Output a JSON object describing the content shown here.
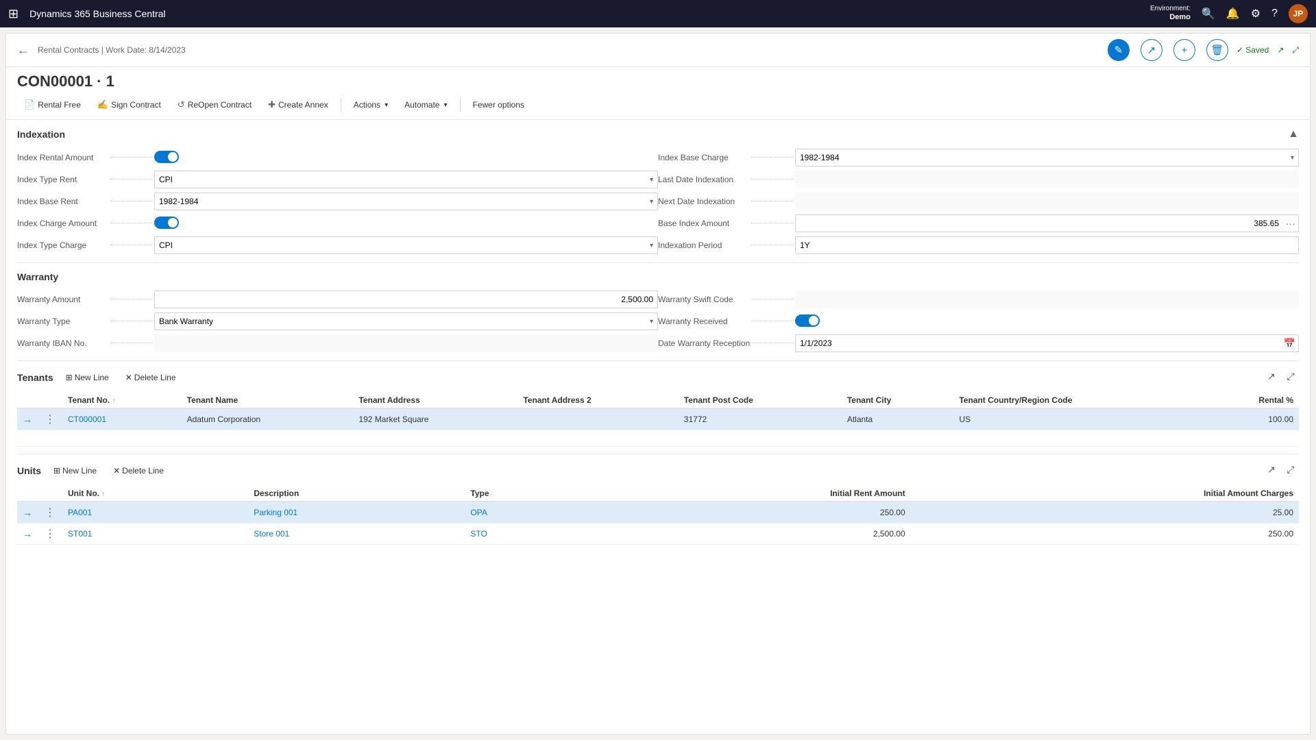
{
  "topNav": {
    "appGridIcon": "⊞",
    "appTitle": "Dynamics 365 Business Central",
    "envLabel": "Environment:",
    "envName": "Demo",
    "searchIcon": "🔍",
    "bellIcon": "🔔",
    "gearIcon": "⚙",
    "helpIcon": "?",
    "avatarInitial": "JP"
  },
  "pageHeader": {
    "backIcon": "←",
    "breadcrumb": "Rental Contracts | Work Date: 8/14/2023",
    "editIcon": "✎",
    "shareIcon": "↗",
    "addIcon": "+",
    "deleteIcon": "🗑",
    "savedLabel": "✓ Saved",
    "openNewIcon": "↗",
    "expandIcon": "⤢"
  },
  "recordTitle": "CON00001 · 1",
  "actionBar": {
    "rentalFreeLabel": "Rental Free",
    "rentalFreeIcon": "📄",
    "signContractLabel": "Sign Contract",
    "signContractIcon": "✍",
    "reopenContractLabel": "ReOpen Contract",
    "reopenContractIcon": "↺",
    "createAnnexLabel": "Create Annex",
    "createAnnexIcon": "✚",
    "actionsLabel": "Actions",
    "automateLabel": "Automate",
    "fewerOptionsLabel": "Fewer options"
  },
  "indexation": {
    "sectionTitle": "Indexation",
    "indexRentalAmountLabel": "Index Rental Amount",
    "indexRentalAmountValue": "on",
    "indexTypeRentLabel": "Index Type Rent",
    "indexTypeRentValue": "CPI",
    "indexBaseRentLabel": "Index Base Rent",
    "indexBaseRentValue": "1982-1984",
    "indexChargeAmountLabel": "Index Charge Amount",
    "indexChargeAmountValue": "on",
    "indexTypeChargeLabel": "Index Type Charge",
    "indexTypeChargeValue": "CPI",
    "indexBaseChargeLabel": "Index Base Charge",
    "indexBaseChargeValue": "1982-1984",
    "lastDateIndexationLabel": "Last Date Indexation",
    "lastDateIndexationValue": "",
    "nextDateIndexationLabel": "Next Date Indexation",
    "nextDateIndexationValue": "",
    "baseIndexAmountLabel": "Base Index Amount",
    "baseIndexAmountValue": "385.65",
    "indexationPeriodLabel": "Indexation Period",
    "indexationPeriodValue": "1Y"
  },
  "warranty": {
    "sectionTitle": "Warranty",
    "warrantyAmountLabel": "Warranty Amount",
    "warrantyAmountValue": "2,500.00",
    "warrantyTypeLabel": "Warranty Type",
    "warrantyTypeValue": "Bank Warranty",
    "warrantyIbanLabel": "Warranty IBAN No.",
    "warrantyIbanValue": "",
    "warrantySwiftCodeLabel": "Warranty Swift Code",
    "warrantySwiftCodeValue": "",
    "warrantyReceivedLabel": "Warranty Received",
    "warrantyReceivedValue": "on",
    "dateWarrantyReceptionLabel": "Date Warranty Reception",
    "dateWarrantyReceptionValue": "1/1/2023"
  },
  "tenants": {
    "sectionTitle": "Tenants",
    "newLineLabel": "New Line",
    "deleteLineLabel": "Delete Line",
    "columns": [
      {
        "key": "tenantNo",
        "label": "Tenant No.",
        "sortable": true
      },
      {
        "key": "tenantName",
        "label": "Tenant Name",
        "sortable": false
      },
      {
        "key": "tenantAddress",
        "label": "Tenant Address",
        "sortable": false
      },
      {
        "key": "tenantAddress2",
        "label": "Tenant Address 2",
        "sortable": false
      },
      {
        "key": "tenantPostCode",
        "label": "Tenant Post Code",
        "sortable": false
      },
      {
        "key": "tenantCity",
        "label": "Tenant City",
        "sortable": false
      },
      {
        "key": "tenantCountry",
        "label": "Tenant Country/Region Code",
        "sortable": false
      },
      {
        "key": "rentalPct",
        "label": "Rental %",
        "sortable": false
      }
    ],
    "rows": [
      {
        "tenantNo": "CT000001",
        "tenantName": "Adatum Corporation",
        "tenantAddress": "192 Market Square",
        "tenantAddress2": "",
        "tenantPostCode": "31772",
        "tenantCity": "Atlanta",
        "tenantCountry": "US",
        "rentalPct": "100.00",
        "selected": true
      }
    ]
  },
  "units": {
    "sectionTitle": "Units",
    "newLineLabel": "New Line",
    "deleteLineLabel": "Delete Line",
    "columns": [
      {
        "key": "unitNo",
        "label": "Unit No.",
        "sortable": true
      },
      {
        "key": "description",
        "label": "Description",
        "sortable": false
      },
      {
        "key": "type",
        "label": "Type",
        "sortable": false
      },
      {
        "key": "initialRentAmount",
        "label": "Initial Rent Amount",
        "sortable": false
      },
      {
        "key": "initialAmountCharges",
        "label": "Initial Amount Charges",
        "sortable": false
      }
    ],
    "rows": [
      {
        "unitNo": "PA001",
        "description": "Parking 001",
        "type": "OPA",
        "initialRentAmount": "250.00",
        "initialAmountCharges": "25.00",
        "selected": true
      },
      {
        "unitNo": "ST001",
        "description": "Store 001",
        "type": "STO",
        "initialRentAmount": "2,500.00",
        "initialAmountCharges": "250.00",
        "selected": false
      }
    ]
  }
}
